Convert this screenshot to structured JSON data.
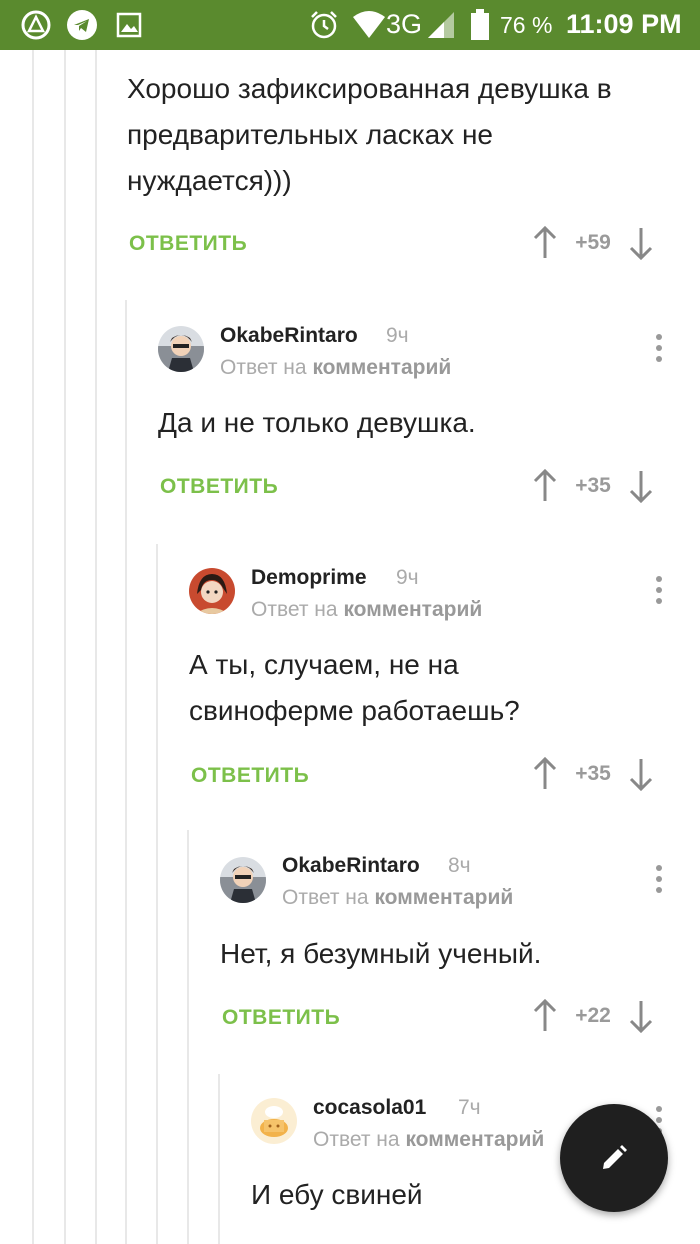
{
  "status_bar": {
    "network": "3G",
    "battery_percent": "76 %",
    "time": "11:09 PM",
    "icons": [
      "app-a-icon",
      "telegram-icon",
      "image-icon",
      "alarm-icon",
      "wifi-icon",
      "signal-icon",
      "battery-icon"
    ]
  },
  "comments": [
    {
      "text_lines": [
        "Хорошо зафиксированная девушка в",
        "предварительных ласках не",
        "нуждается)))"
      ],
      "reply_label": "ОТВЕТИТЬ",
      "score": "+59"
    },
    {
      "username": "OkabeRintaro",
      "time": "9ч",
      "reply_to_prefix": "Ответ на",
      "reply_to_target": "комментарий",
      "text_lines": [
        "Да и не только девушка."
      ],
      "reply_label": "ОТВЕТИТЬ",
      "score": "+35"
    },
    {
      "username": "Demoprime",
      "time": "9ч",
      "reply_to_prefix": "Ответ на",
      "reply_to_target": "комментарий",
      "text_lines": [
        "А ты, случаем, не на",
        "свиноферме работаешь?"
      ],
      "reply_label": "ОТВЕТИТЬ",
      "score": "+35"
    },
    {
      "username": "OkabeRintaro",
      "time": "8ч",
      "reply_to_prefix": "Ответ на",
      "reply_to_target": "комментарий",
      "text_lines": [
        "Нет, я безумный ученый."
      ],
      "reply_label": "ОТВЕТИТЬ",
      "score": "+22"
    },
    {
      "username": "cocasola01",
      "time": "7ч",
      "reply_to_prefix": "Ответ на",
      "reply_to_target": "комментарий",
      "text_lines": [
        "И ебу свиней"
      ]
    }
  ],
  "colors": {
    "status_bar": "#5a8a2e",
    "reply_green": "#7cc04a",
    "fab": "#1f1f1f"
  }
}
